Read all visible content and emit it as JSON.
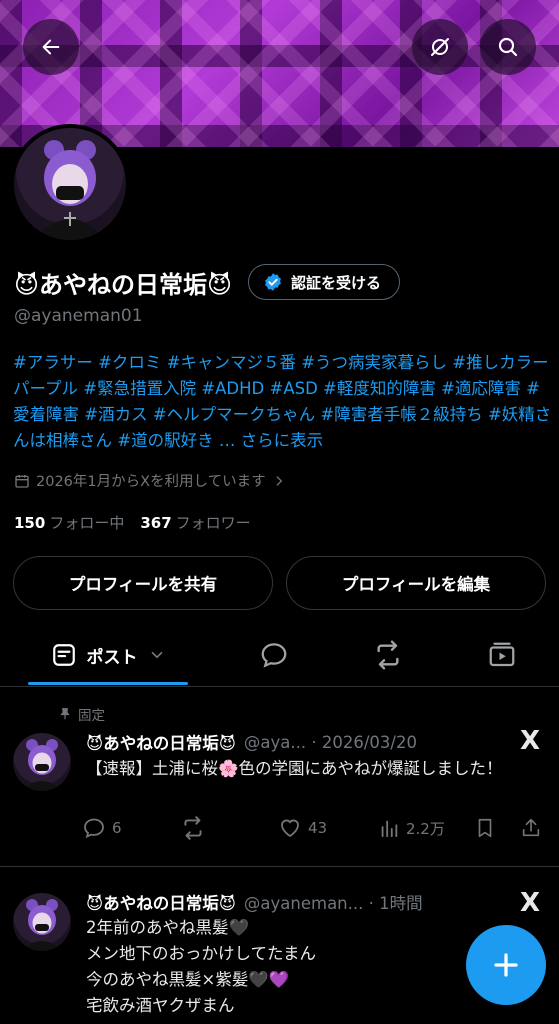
{
  "profile": {
    "display_name": "😈あやねの日常垢😈",
    "verify_label": "認証を受ける",
    "handle": "@ayaneman01",
    "bio": "#アラサー #クロミ #キャンマジ５番 #うつ病実家暮らし #推しカラーパープル #緊急措置入院 #ADHD #ASD #軽度知的障害 #適応障害 #愛着障害 #酒カス #ヘルプマークちゃん #障害者手帳２級持ち #妖精さんは相棒さん #道の駅好き …",
    "bio_more": "さらに表示",
    "joined": "2026年1月からXを利用しています",
    "following_count": "150",
    "following_label": "フォロー中",
    "followers_count": "367",
    "followers_label": "フォロワー",
    "share_button": "プロフィールを共有",
    "edit_button": "プロフィールを編集"
  },
  "tabs": {
    "posts_label": "ポスト"
  },
  "pinned_label": "固定",
  "posts": [
    {
      "name": "😈あやねの日常垢😈",
      "meta": "@aya... · 2026/03/20",
      "body": "【速報】土浦に桜🌸色の学園にあやねが爆誕しました！",
      "replies": "6",
      "likes": "43",
      "views": "2.2万"
    },
    {
      "name": "😈あやねの日常垢😈",
      "meta": "@ayaneman... · 1時間",
      "body_lines": [
        "2年前のあやね黒髪🖤",
        "メン地下のおっかけしてたまん",
        "今のあやね黒髪×紫髪🖤💜",
        "宅飲み酒ヤクザまん"
      ]
    }
  ],
  "x_logo": "X",
  "colors": {
    "accent": "#1d9bf0",
    "muted": "#71767b",
    "background": "#000000"
  },
  "icons": [
    "back-arrow-icon",
    "no-sync-icon",
    "search-icon",
    "verified-badge-icon",
    "calendar-icon",
    "chevron-right-icon",
    "posts-icon",
    "chevron-down-icon",
    "replies-icon",
    "retweet-icon",
    "media-icon",
    "pin-icon",
    "reply-icon",
    "like-icon",
    "views-icon",
    "bookmark-icon",
    "share-icon",
    "plus-icon"
  ]
}
